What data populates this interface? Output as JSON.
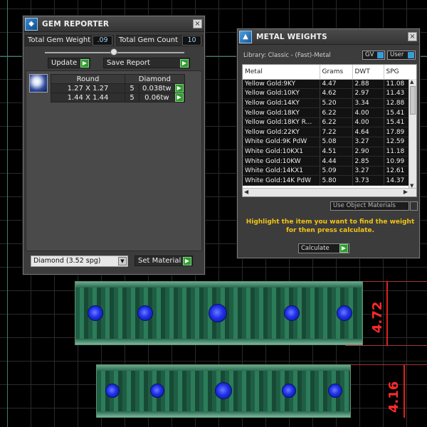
{
  "gem_reporter": {
    "title": "GEM REPORTER",
    "close": "×",
    "total_gem_weight_label": "Total Gem Weight",
    "total_gem_weight_value": ".09",
    "total_gem_count_label": "Total Gem Count",
    "total_gem_count_value": "10",
    "update_label": "Update",
    "save_report_label": "Save Report",
    "table_headers": [
      "Round",
      "Diamond"
    ],
    "rows": [
      {
        "size": "1.27 X 1.27",
        "count": "5",
        "weight": "0.038tw"
      },
      {
        "size": "1.44 X 1.44",
        "count": "5",
        "weight": "0.06tw"
      }
    ],
    "material_select": "Diamond     (3.52 spg)",
    "set_material_label": "Set Material"
  },
  "metal_weights": {
    "title": "METAL WEIGHTS",
    "close": "×",
    "library": "Library: Classic - (Fast)-Metal",
    "gv_label": "GV",
    "user_label": "User",
    "columns": [
      "Metal",
      "Grams",
      "DWT",
      "SPG"
    ],
    "rows": [
      [
        "Yellow Gold:9KY",
        "4.47",
        "2.88",
        "11.08"
      ],
      [
        "Yellow Gold:10KY",
        "4.62",
        "2.97",
        "11.43"
      ],
      [
        "Yellow Gold:14KY",
        "5.20",
        "3.34",
        "12.88"
      ],
      [
        "Yellow Gold:18KY",
        "6.22",
        "4.00",
        "15.41"
      ],
      [
        "Yellow Gold:18KY R...",
        "6.22",
        "4.00",
        "15.41"
      ],
      [
        "Yellow Gold:22KY",
        "7.22",
        "4.64",
        "17.89"
      ],
      [
        "White Gold:9K PdW",
        "5.08",
        "3.27",
        "12.59"
      ],
      [
        "White Gold:10KX1",
        "4.51",
        "2.90",
        "11.18"
      ],
      [
        "White Gold:10KW",
        "4.44",
        "2.85",
        "10.99"
      ],
      [
        "White Gold:14KX1",
        "5.09",
        "3.27",
        "12.61"
      ],
      [
        "White Gold:14K PdW",
        "5.80",
        "3.73",
        "14.37"
      ]
    ],
    "use_object_materials": "Use Object Materials",
    "hint": "Highlight the item you want to find the weight for then press calculate.",
    "calculate_label": "Calculate"
  },
  "viewport": {
    "dim_top": "4.72",
    "dim_bottom": "4.16"
  },
  "colors": {
    "gem_blue": "#1f2fe8",
    "band_green": "#2c7c5a",
    "dimension_red": "#e02020",
    "hint_yellow": "#f3c316"
  }
}
